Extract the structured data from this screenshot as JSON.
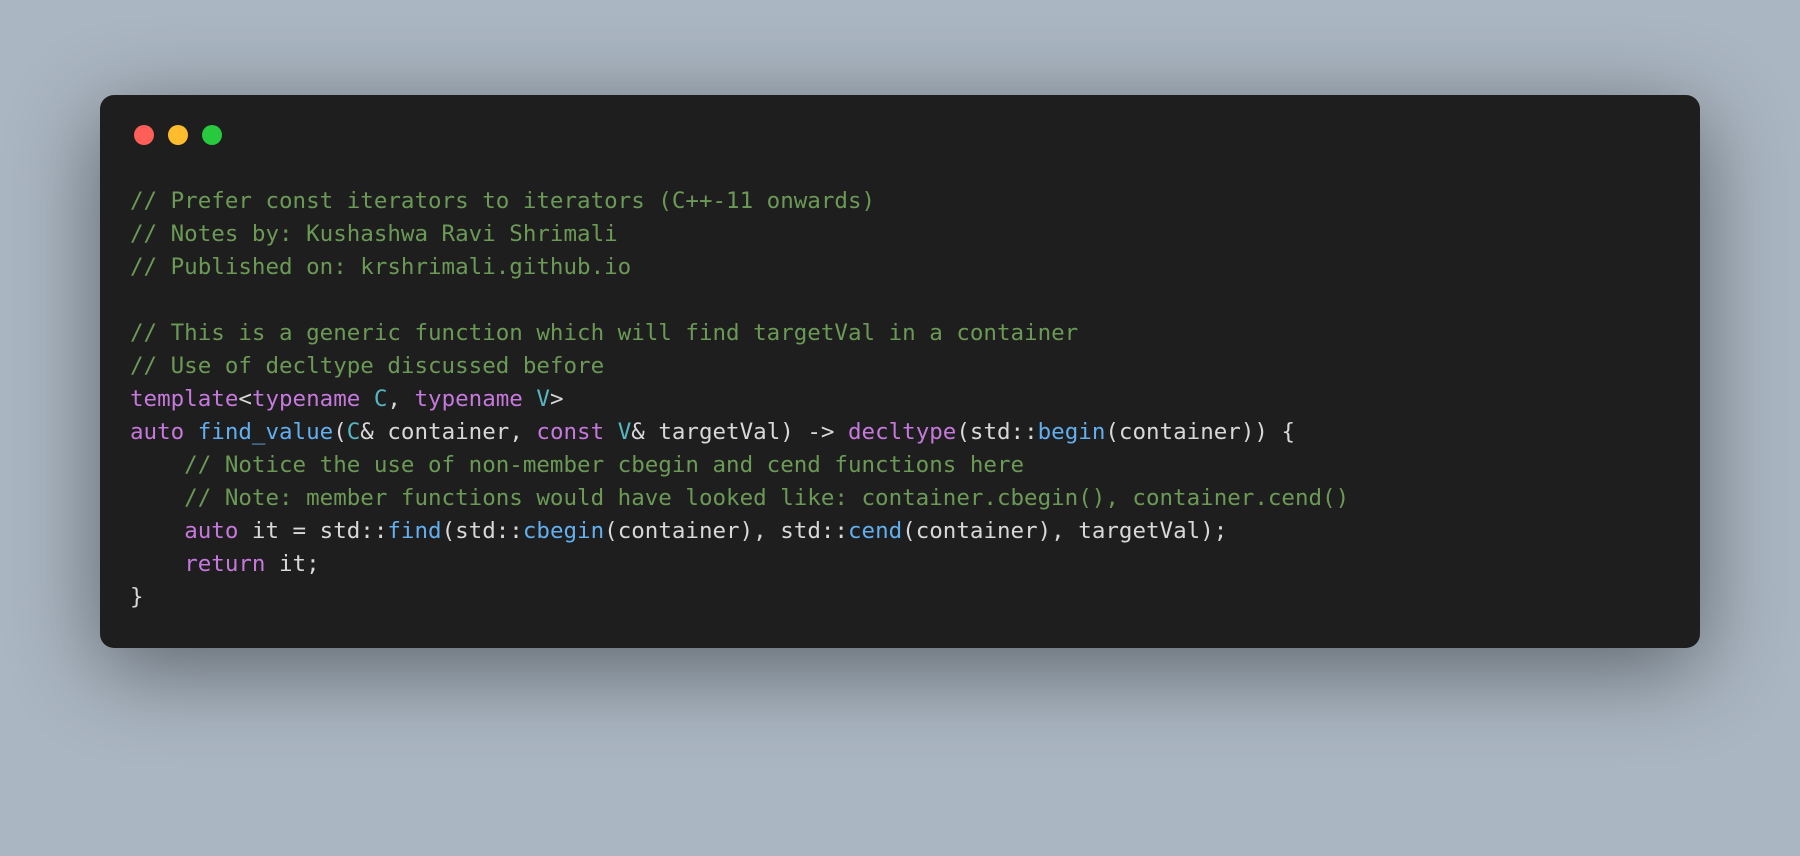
{
  "code": {
    "line01_comment": "// Prefer const iterators to iterators (C++-11 onwards)",
    "line02_comment": "// Notes by: Kushashwa Ravi Shrimali",
    "line03_comment": "// Published on: krshrimali.github.io",
    "line05_comment": "// This is a generic function which will find targetVal in a container",
    "line06_comment": "// Use of decltype discussed before",
    "line07": {
      "kw_template": "template",
      "lt": "<",
      "kw_typename1": "typename",
      "type_C": " C",
      "comma": ", ",
      "kw_typename2": "typename",
      "type_V": " V",
      "gt": ">"
    },
    "line08": {
      "kw_auto": "auto",
      "sp1": " ",
      "fn_name": "find_value",
      "open_paren": "(",
      "type_Cref": "C",
      "amp1": "& ",
      "param_container": "container",
      "comma_sp": ", ",
      "kw_const": "const",
      "sp2": " ",
      "type_Vref": "V",
      "amp2": "& ",
      "param_target": "targetVal",
      "close_paren_arrow": ") -> ",
      "kw_decltype": "decltype",
      "open2": "(",
      "ns_std1": "std",
      "dcolon1": "::",
      "fn_begin": "begin",
      "open3": "(",
      "arg_container1": "container",
      "close3": ")) {"
    },
    "line09_comment": "    // Notice the use of non-member cbegin and cend functions here",
    "line10_comment": "    // Note: member functions would have looked like: container.cbegin(), container.cend()",
    "line11": {
      "indent": "    ",
      "kw_auto": "auto",
      "sp": " ",
      "var_it": "it",
      "eq": " = ",
      "ns_std1": "std",
      "dcolon1": "::",
      "fn_find": "find",
      "open": "(",
      "ns_std2": "std",
      "dcolon2": "::",
      "fn_cbegin": "cbegin",
      "open2": "(",
      "arg_container1": "container",
      "close2": "), ",
      "ns_std3": "std",
      "dcolon3": "::",
      "fn_cend": "cend",
      "open3": "(",
      "arg_container2": "container",
      "close3": "), ",
      "arg_target": "targetVal",
      "close": ");"
    },
    "line12": {
      "indent": "    ",
      "kw_return": "return",
      "sp": " ",
      "var_it": "it",
      "semi": ";"
    },
    "line13_brace": "}"
  },
  "colors": {
    "page_bg": "#aab6c2",
    "card_bg": "#1e1e1e",
    "traffic_red": "#ff5f56",
    "traffic_yellow": "#ffbd2e",
    "traffic_green": "#27c93f",
    "comment": "#6b9a56",
    "keyword": "#c678dd",
    "type": "#56b6c2",
    "function": "#61afef",
    "identifier": "#d8d8d8"
  }
}
